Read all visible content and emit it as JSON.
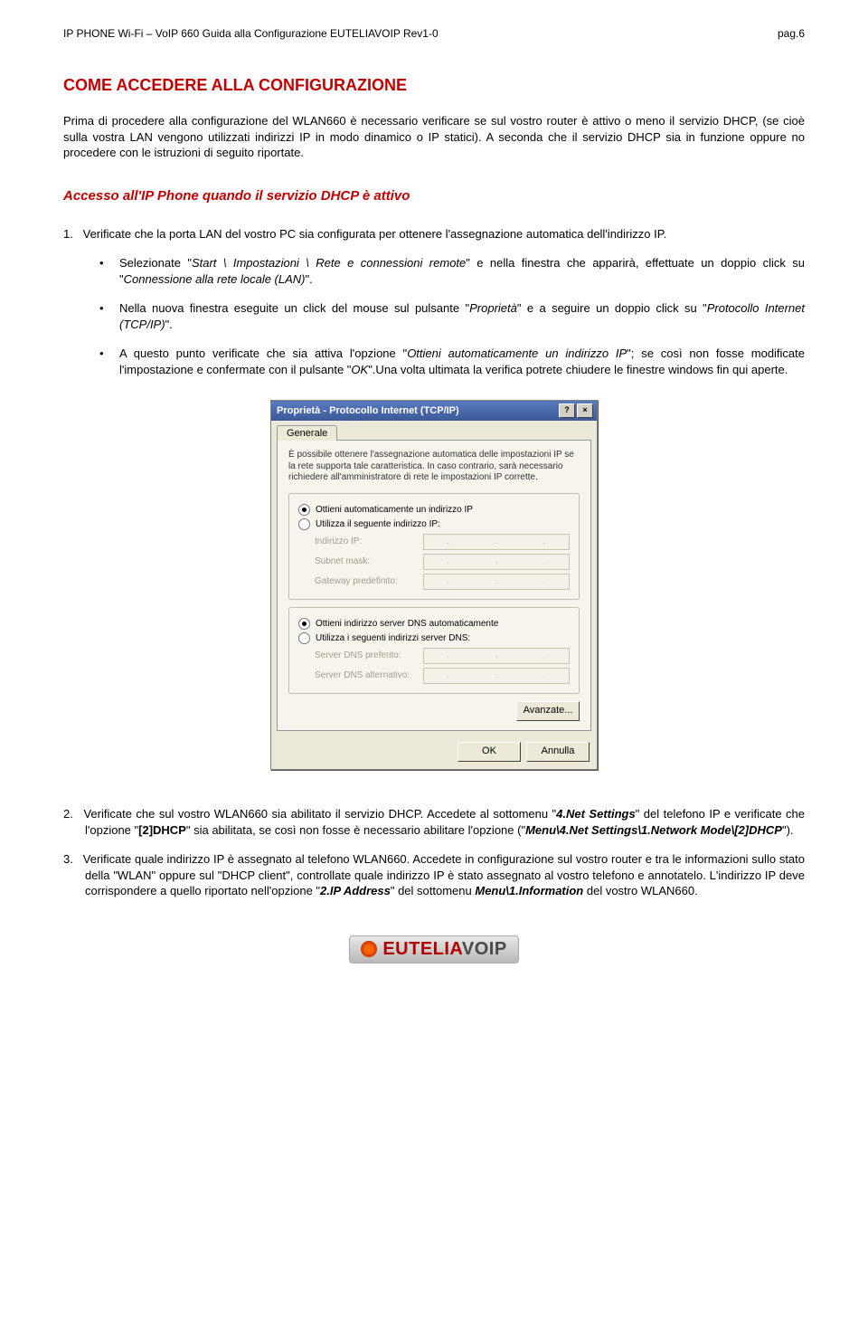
{
  "header": {
    "left": "IP PHONE Wi-Fi – VoIP 660 Guida alla Configurazione EUTELIAVOIP Rev1-0",
    "right": "pag.6"
  },
  "section_title": "COME ACCEDERE ALLA CONFIGURAZIONE",
  "intro_para": "Prima di procedere alla configurazione del WLAN660 è necessario verificare se sul vostro router è attivo o meno il servizio DHCP, (se cioè sulla vostra LAN vengono utilizzati indirizzi IP in modo dinamico o IP statici). A seconda che il servizio DHCP sia in funzione oppure no procedere con le istruzioni di seguito riportate.",
  "subsection_title": "Accesso all'IP Phone quando il servizio DHCP è attivo",
  "step1": {
    "num": "1.",
    "text": "Verificate che la porta LAN del vostro PC sia configurata per ottenere l'assegnazione automatica dell'indirizzo IP."
  },
  "bullets": {
    "b1_pre": "Selezionate \"",
    "b1_em": "Start \\ Impostazioni \\ Rete e connessioni remote",
    "b1_mid": "\" e nella finestra che apparirà, effettuate un doppio click su \"",
    "b1_em2": "Connessione alla rete locale (LAN)",
    "b1_post": "\".",
    "b2_pre": "Nella nuova finestra eseguite un click del mouse sul pulsante \"",
    "b2_em": "Proprietà",
    "b2_mid": "\" e a seguire un doppio click su \"",
    "b2_em2": "Protocollo Internet (TCP/IP)",
    "b2_post": "\".",
    "b3_pre": "A questo punto verificate che sia attiva l'opzione \"",
    "b3_em": "Ottieni automaticamente un indirizzo IP",
    "b3_mid": "\"; se così non fosse modificate l'impostazione e confermate con il pulsante \"",
    "b3_em2": "OK",
    "b3_post": "\".Una volta ultimata la verifica potrete chiudere le finestre windows fin qui aperte."
  },
  "dialog": {
    "title": "Proprietà - Protocollo Internet (TCP/IP)",
    "help_btn": "?",
    "close_btn": "×",
    "tab": "Generale",
    "desc": "È possibile ottenere l'assegnazione automatica delle impostazioni IP se la rete supporta tale caratteristica. In caso contrario, sarà necessario richiedere all'amministratore di rete le impostazioni IP corrette.",
    "radio_ip_auto": "Ottieni automaticamente un indirizzo IP",
    "radio_ip_manual": "Utilizza il seguente indirizzo IP:",
    "label_ip": "Indirizzo IP:",
    "label_subnet": "Subnet mask:",
    "label_gateway": "Gateway predefinito:",
    "radio_dns_auto": "Ottieni indirizzo server DNS automaticamente",
    "radio_dns_manual": "Utilizza i seguenti indirizzi server DNS:",
    "label_dns1": "Server DNS preferito:",
    "label_dns2": "Server DNS alternativo:",
    "btn_advanced": "Avanzate...",
    "btn_ok": "OK",
    "btn_cancel": "Annulla"
  },
  "step2": {
    "num": "2.",
    "t1": "Verificate che sul vostro WLAN660 sia abilitato il servizio DHCP. Accedete al sottomenu \"",
    "em1": "4.Net Settings",
    "t2": "\" del telefono IP e verificate che l'opzione \"",
    "b1": "[2]DHCP",
    "t3": "\" sia abilitata, se così non fosse è necessario abilitare l'opzione (\"",
    "em2": "Menu\\4.Net Settings\\1.Network Mode\\[2]DHCP",
    "t4": "\")."
  },
  "step3": {
    "num": "3.",
    "t1": "Verificate quale indirizzo IP è assegnato al telefono WLAN660. Accedete in configurazione sul vostro router e tra le informazioni sullo stato della \"WLAN\" oppure sul \"DHCP client\", controllate quale indirizzo IP è stato assegnato al vostro telefono e annotatelo. L'indirizzo IP deve corrispondere a quello riportato nell'opzione \"",
    "em1": "2.IP Address",
    "t2": "\" del sottomenu ",
    "em2": "Menu\\1.Information",
    "t3": " del vostro WLAN660."
  },
  "logo": {
    "part1": "EUTELIA",
    "part2": "VOIP"
  }
}
